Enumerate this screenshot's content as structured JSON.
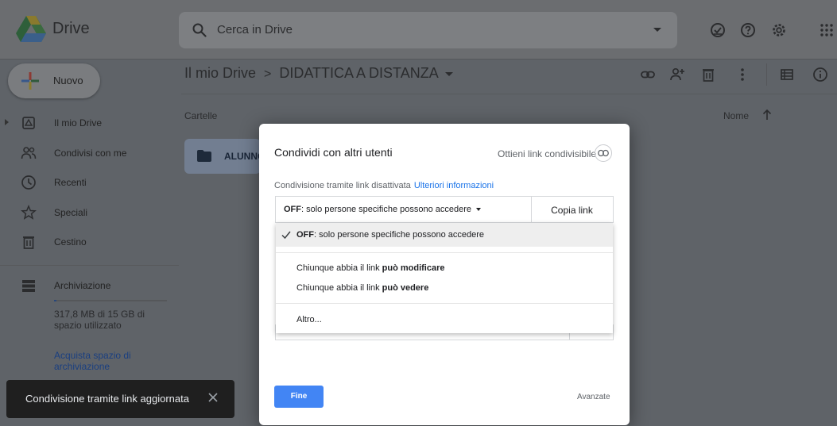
{
  "header": {
    "brand": "Drive",
    "search_placeholder": "Cerca in Drive",
    "icons": [
      "offline-check-icon",
      "help-icon",
      "settings-gear-icon",
      "apps-grid-icon"
    ]
  },
  "new_button": {
    "label": "Nuovo"
  },
  "breadcrumb": {
    "root": "Il mio Drive",
    "separator": ">",
    "current": "DIDATTICA A DISTANZA"
  },
  "toolbar_icons": [
    "link-icon",
    "add-person-icon",
    "trash-icon",
    "more-vert-icon",
    "list-view-icon",
    "info-icon"
  ],
  "sidebar": {
    "items": [
      {
        "label": "Il mio Drive",
        "icon": "my-drive-icon"
      },
      {
        "label": "Condivisi con me",
        "icon": "shared-people-icon"
      },
      {
        "label": "Recenti",
        "icon": "clock-icon"
      },
      {
        "label": "Speciali",
        "icon": "star-icon"
      },
      {
        "label": "Cestino",
        "icon": "trash-icon"
      }
    ],
    "storage": {
      "label": "Archiviazione",
      "usage_text": "317,8 MB di 15 GB di spazio utilizzato",
      "used_fraction": 0.0207,
      "buy_link": "Acquista spazio di archiviazione"
    }
  },
  "main": {
    "section_label": "Cartelle",
    "sort_label": "Nome",
    "folders": [
      {
        "name": "ALUNNO"
      }
    ]
  },
  "toast": {
    "text": "Condivisione tramite link aggiornata"
  },
  "dialog": {
    "title": "Condividi con altri utenti",
    "get_link": "Ottieni link condivisibile",
    "status": "Condivisione tramite link disattivata",
    "more_info": "Ulteriori informazioni",
    "dropdown_bold": "OFF",
    "dropdown_rest": ": solo persone specifiche possono accedere",
    "copy_link": "Copia link",
    "menu": {
      "selected_bold": "OFF",
      "selected_rest": ": solo persone specifiche possono accedere",
      "edit_prefix": "Chiunque abbia il link ",
      "edit_bold": "può modificare",
      "view_prefix": "Chiunque abbia il link ",
      "view_bold": "può vedere",
      "other": "Altro..."
    },
    "done_button": "Fine",
    "advanced": "Avanzate"
  },
  "colors": {
    "overlay_gray": "#5f6368",
    "accent_blue": "#4285f4",
    "link_blue": "#1a73e8",
    "toast_bg": "#1f1f1f"
  }
}
